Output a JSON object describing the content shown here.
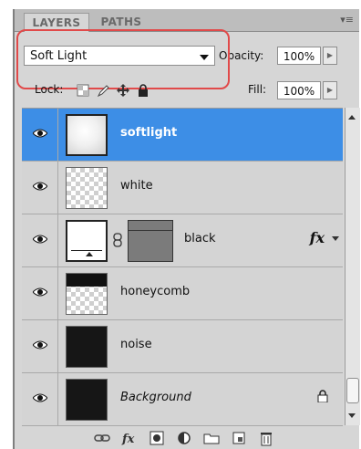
{
  "tabs": {
    "layers": "LAYERS",
    "paths": "PATHS"
  },
  "blend": {
    "mode": "Soft Light",
    "opacity_label": "Opacity:",
    "opacity_value": "100%"
  },
  "lock": {
    "label": "Lock:"
  },
  "fill": {
    "label": "Fill:",
    "value": "100%"
  },
  "layers": [
    {
      "name": "softlight",
      "selected": true
    },
    {
      "name": "white",
      "selected": false
    },
    {
      "name": "black",
      "selected": false,
      "fx": "fx"
    },
    {
      "name": "honeycomb",
      "selected": false
    },
    {
      "name": "noise",
      "selected": false
    },
    {
      "name": "Background",
      "selected": false
    }
  ],
  "colors": {
    "selected_row": "#3d8ee6",
    "highlight": "#e14a4a"
  },
  "icons": [
    "eye-icon",
    "link-layers-icon",
    "fx-icon",
    "mask-icon",
    "adjustment-icon",
    "group-folder-icon",
    "new-layer-icon",
    "trash-icon",
    "lock-icon"
  ]
}
